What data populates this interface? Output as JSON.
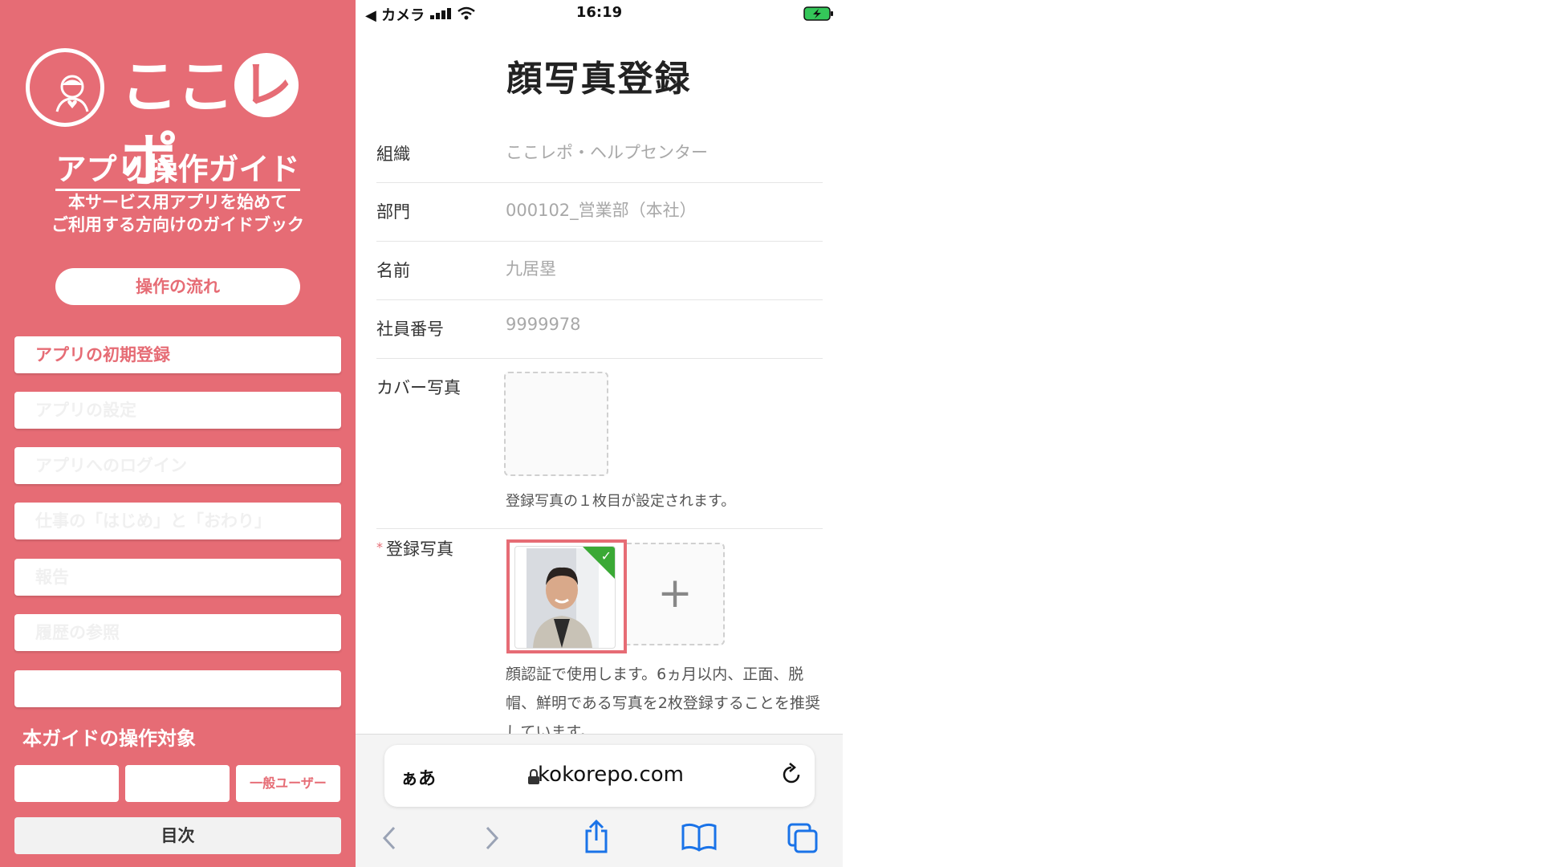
{
  "guide": {
    "logo_text_1": "ここ",
    "logo_text_re": "レ",
    "logo_text_2": "ポ",
    "title": "アプリ操作ガイド",
    "subtitle_line1": "本サービス用アプリを始めて",
    "subtitle_line2": "ご利用する方向けのガイドブック",
    "flow_button": "操作の流れ",
    "menu": [
      {
        "label": "アプリの初期登録"
      },
      {
        "label": "アプリの設定"
      },
      {
        "label": "アプリへのログイン"
      },
      {
        "label": "仕事の「はじめ」と「おわり」"
      },
      {
        "label": "報告"
      },
      {
        "label": "履歴の参照"
      },
      {
        "label": ""
      }
    ],
    "target_title": "本ガイドの操作対象",
    "targets": [
      "",
      "",
      "一般ユーザー"
    ],
    "toc_button": "目次",
    "colors": {
      "accent": "#e66c75"
    }
  },
  "phone": {
    "status": {
      "back_app": "◀ カメラ",
      "time": "16:19"
    },
    "page_title": "顔写真登録",
    "rows": [
      {
        "label": "組織",
        "value": "ここレポ・ヘルプセンター"
      },
      {
        "label": "部門",
        "value": "000102_営業部（本社）"
      },
      {
        "label": "名前",
        "value": "九居塁"
      },
      {
        "label": "社員番号",
        "value": "9999978"
      }
    ],
    "cover_label": "カバー写真",
    "cover_note": "登録写真の１枚目が設定されます。",
    "photo_required_mark": "*",
    "photo_label": "登録写真",
    "photo_check": "✓",
    "add_symbol": "+",
    "face_note": "顔認証で使用します。6ヵ月以内、正面、脱帽、鮮明である写真を2枚登録することを推奨しています。",
    "safari": {
      "aa": "ぁあ",
      "url": "kokorepo.com"
    }
  }
}
